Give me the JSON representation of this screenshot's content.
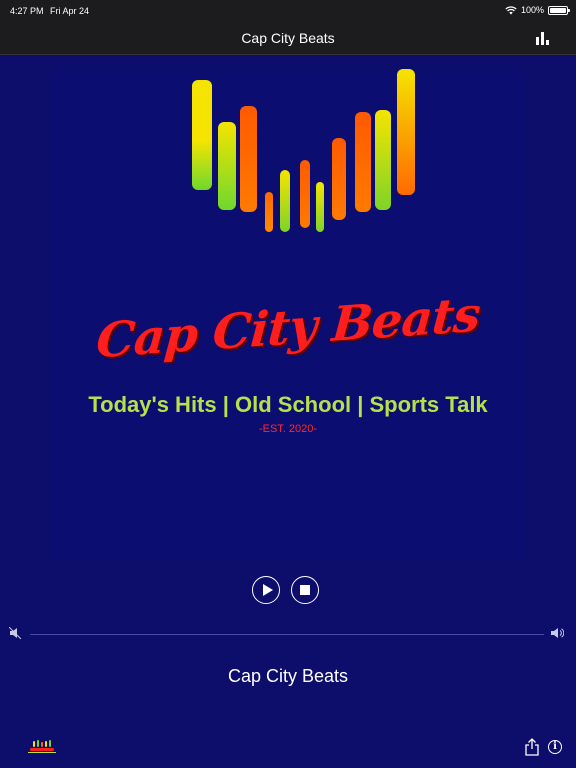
{
  "status": {
    "time": "4:27 PM",
    "date": "Fri Apr 24",
    "battery_text": "100%",
    "battery_level": 1.0,
    "wifi_icon": "wifi-icon"
  },
  "nav": {
    "title": "Cap City Beats",
    "equalizer_icon": "equalizer-icon"
  },
  "artwork": {
    "logo_text": "Cap City Beats",
    "tagline": "Today's Hits | Old School | Sports Talk",
    "est": "-EST. 2020-"
  },
  "controls": {
    "play_icon": "play-icon",
    "stop_icon": "stop-icon"
  },
  "volume": {
    "level": 1.0,
    "min_icon": "volume-min-icon",
    "max_icon": "volume-max-icon"
  },
  "station": {
    "name": "Cap City Beats"
  },
  "toolbar": {
    "share_icon": "share-icon",
    "info_icon": "info-icon"
  },
  "colors": {
    "background": "#0d0d6b",
    "bar_dark": "#1c1c1e",
    "logo_red": "#ff1e1e",
    "tagline_green": "#b8e04a"
  }
}
